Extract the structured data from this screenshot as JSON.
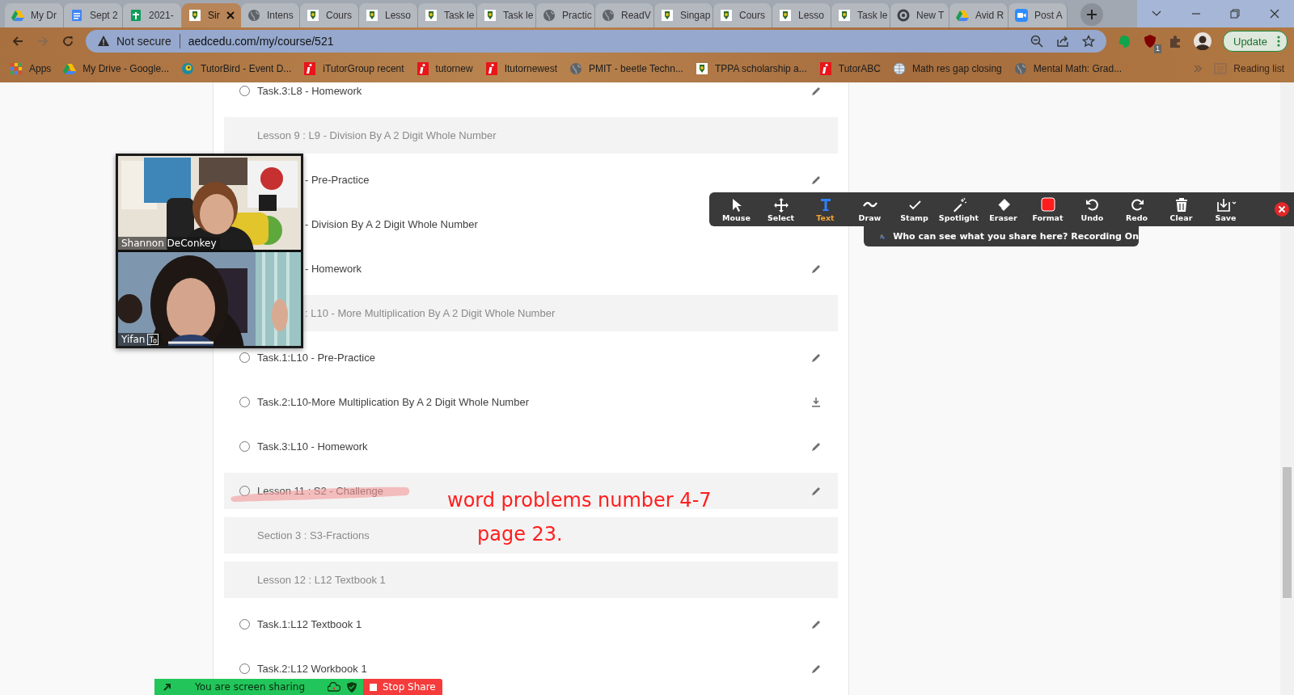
{
  "tabs": [
    {
      "title": "My Dr",
      "kind": "drive",
      "selected": false
    },
    {
      "title": "Sept 2",
      "kind": "docs",
      "selected": false
    },
    {
      "title": "2021-",
      "kind": "sheets",
      "selected": false
    },
    {
      "title": "Sir",
      "kind": "crest",
      "selected": true
    },
    {
      "title": "Intens",
      "kind": "globe",
      "selected": false
    },
    {
      "title": "Cours",
      "kind": "crest",
      "selected": false
    },
    {
      "title": "Lesso",
      "kind": "crest",
      "selected": false
    },
    {
      "title": "Task le",
      "kind": "crest",
      "selected": false
    },
    {
      "title": "Task le",
      "kind": "crest",
      "selected": false
    },
    {
      "title": "Practic",
      "kind": "globe",
      "selected": false
    },
    {
      "title": "ReadV",
      "kind": "globe",
      "selected": false
    },
    {
      "title": "Singap",
      "kind": "crest",
      "selected": false
    },
    {
      "title": "Cours",
      "kind": "crest",
      "selected": false
    },
    {
      "title": "Lesso",
      "kind": "crest",
      "selected": false
    },
    {
      "title": "Task le",
      "kind": "crest",
      "selected": false
    },
    {
      "title": "New T",
      "kind": "chrome",
      "selected": false
    },
    {
      "title": "Avid R",
      "kind": "drive",
      "selected": false
    },
    {
      "title": "Post A",
      "kind": "zoom",
      "selected": false
    }
  ],
  "address_bar": {
    "security": "Not secure",
    "url": "aedcedu.com/my/course/521"
  },
  "extension_badge": "1",
  "update_button": "Update",
  "bookmarks": [
    {
      "label": "Apps",
      "kind": "apps"
    },
    {
      "label": "My Drive - Google...",
      "kind": "drive"
    },
    {
      "label": "TutorBird - Event D...",
      "kind": "bird"
    },
    {
      "label": "iTutorGroup recent",
      "kind": "info"
    },
    {
      "label": "tutornew",
      "kind": "info"
    },
    {
      "label": "Itutornewest",
      "kind": "info"
    },
    {
      "label": "PMIT - beetle Techn...",
      "kind": "globe"
    },
    {
      "label": "TPPA scholarship a...",
      "kind": "crest"
    },
    {
      "label": "TutorABC",
      "kind": "info"
    },
    {
      "label": "Math res gap closing",
      "kind": "world"
    },
    {
      "label": "Mental Math: Grad...",
      "kind": "globe"
    }
  ],
  "reading_list": "Reading list",
  "course_rows": [
    {
      "kind": "task",
      "text": "Task.3:L8 - Homework",
      "checked": false,
      "action": {
        "kind": "edit"
      }
    },
    {
      "kind": "header",
      "text": "Lesson 9 : L9 - Division By A 2 Digit Whole Number"
    },
    {
      "kind": "task_partial",
      "text": "- Pre-Practice",
      "action": {
        "kind": "edit"
      }
    },
    {
      "kind": "task_partial",
      "text": "- Division By A 2 Digit Whole Number"
    },
    {
      "kind": "task_partial",
      "text": "- Homework",
      "action": {
        "kind": "edit"
      }
    },
    {
      "kind": "header_partial",
      "text": ": L10 - More Multiplication By A 2 Digit Whole Number"
    },
    {
      "kind": "task",
      "text": "Task.1:L10 - Pre-Practice",
      "checked": false,
      "action": {
        "kind": "edit"
      }
    },
    {
      "kind": "task",
      "text": "Task.2:L10-More Multiplication By A 2 Digit Whole Number",
      "checked": false,
      "action": {
        "kind": "download"
      }
    },
    {
      "kind": "task",
      "text": "Task.3:L10 - Homework",
      "checked": false,
      "action": {
        "kind": "edit"
      }
    },
    {
      "kind": "task_band",
      "text": "Lesson 11 : S2 - Challenge",
      "checked": false,
      "action": {
        "kind": "edit"
      }
    },
    {
      "kind": "header",
      "text": "Section 3 : S3-Fractions"
    },
    {
      "kind": "header",
      "text": "Lesson 12 : L12 Textbook 1"
    },
    {
      "kind": "task",
      "text": "Task.1:L12 Textbook 1",
      "checked": false,
      "action": {
        "kind": "edit"
      }
    },
    {
      "kind": "task",
      "text": "Task.2:L12 Workbook 1",
      "checked": false,
      "action": {
        "kind": "edit"
      }
    }
  ],
  "video_panel": {
    "participants": [
      {
        "name": "Shannon DeConkey",
        "caption_icon": false
      },
      {
        "name": "Yifan",
        "caption_icon": true
      }
    ]
  },
  "annotation_toolbar": {
    "tools": [
      {
        "label": "Mouse",
        "kind": "mouse",
        "selected": false
      },
      {
        "label": "Select",
        "kind": "select",
        "selected": false
      },
      {
        "label": "Text",
        "kind": "text",
        "selected": true
      },
      {
        "label": "Draw",
        "kind": "draw",
        "selected": false
      },
      {
        "label": "Stamp",
        "kind": "stamp",
        "selected": false
      },
      {
        "label": "Spotlight",
        "kind": "spotlight",
        "selected": false
      },
      {
        "label": "Eraser",
        "kind": "eraser",
        "selected": false
      },
      {
        "label": "Format",
        "kind": "format",
        "selected": false
      },
      {
        "label": "Undo",
        "kind": "undo",
        "selected": false
      },
      {
        "label": "Redo",
        "kind": "redo",
        "selected": false
      },
      {
        "label": "Clear",
        "kind": "clear",
        "selected": false
      },
      {
        "label": "Save",
        "kind": "save",
        "selected": false
      }
    ],
    "notice": "Who can see what you share here? Recording On"
  },
  "annotations": [
    {
      "text": "word problems number 4-7"
    },
    {
      "text": "page 23."
    }
  ],
  "sharing_bar": {
    "status": "You are screen sharing",
    "stop_button": "Stop Share"
  }
}
